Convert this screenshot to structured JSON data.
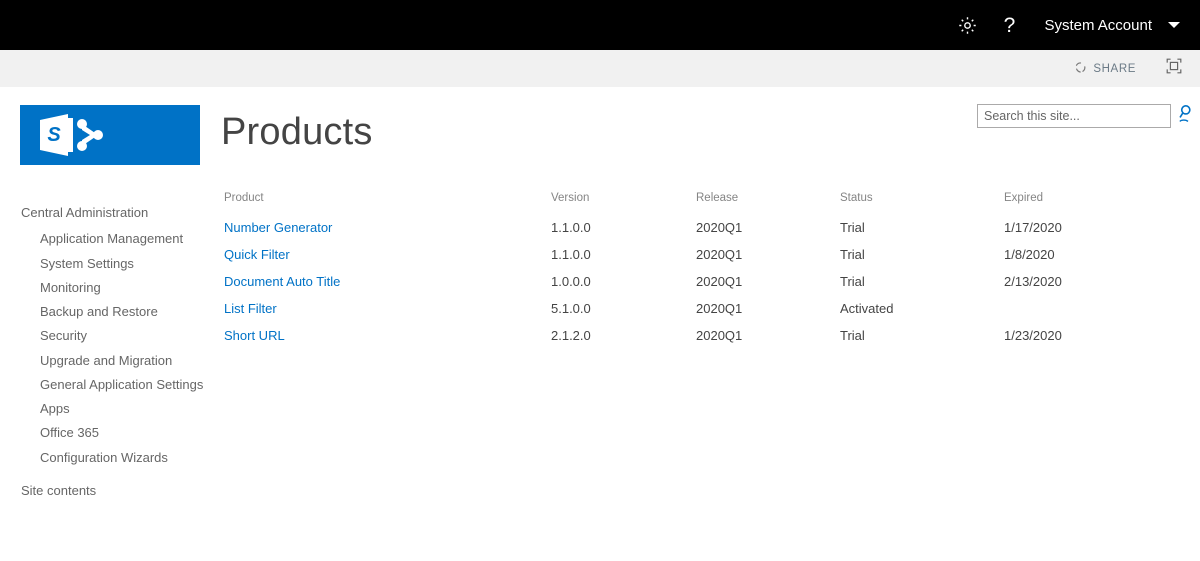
{
  "suitebar": {
    "settings_icon": "gear-icon",
    "help_icon": "question-mark-icon",
    "account_label": "System Account",
    "caret_icon": "chevron-down-icon"
  },
  "ribbon": {
    "share_icon": "share-icon",
    "share_label": "SHARE",
    "focus_icon": "focus-on-content-icon"
  },
  "branding": {
    "logo_icon": "sharepoint-logo-icon",
    "logo_color": "#0072c6",
    "logo_letter": "S"
  },
  "header": {
    "title": "Products"
  },
  "search": {
    "placeholder": "Search this site...",
    "value": "",
    "icon": "search-icon",
    "icon_color": "#0072c6"
  },
  "sidebar": {
    "items": [
      {
        "label": "Central Administration",
        "level": "top"
      },
      {
        "label": "Application Management",
        "level": "child"
      },
      {
        "label": "System Settings",
        "level": "child"
      },
      {
        "label": "Monitoring",
        "level": "child"
      },
      {
        "label": "Backup and Restore",
        "level": "child"
      },
      {
        "label": "Security",
        "level": "child"
      },
      {
        "label": "Upgrade and Migration",
        "level": "child"
      },
      {
        "label": "General Application Settings",
        "level": "child"
      },
      {
        "label": "Apps",
        "level": "child"
      },
      {
        "label": "Office 365",
        "level": "child"
      },
      {
        "label": "Configuration Wizards",
        "level": "child"
      },
      {
        "label": "Site contents",
        "level": "bottom"
      }
    ]
  },
  "main": {
    "table": {
      "columns": [
        "Product",
        "Version",
        "Release",
        "Status",
        "Expired"
      ],
      "rows": [
        {
          "product": "Number Generator",
          "version": "1.1.0.0",
          "release": "2020Q1",
          "status": "Trial",
          "expired": "1/17/2020"
        },
        {
          "product": "Quick Filter",
          "version": "1.1.0.0",
          "release": "2020Q1",
          "status": "Trial",
          "expired": "1/8/2020"
        },
        {
          "product": "Document Auto Title",
          "version": "1.0.0.0",
          "release": "2020Q1",
          "status": "Trial",
          "expired": "2/13/2020"
        },
        {
          "product": "List Filter",
          "version": "5.1.0.0",
          "release": "2020Q1",
          "status": "Activated",
          "expired": ""
        },
        {
          "product": "Short URL",
          "version": "2.1.2.0",
          "release": "2020Q1",
          "status": "Trial",
          "expired": "1/23/2020"
        }
      ]
    }
  },
  "colors": {
    "accent": "#0072c6",
    "suitebar_bg": "#000000",
    "ribbon_bg": "#f1f1f1",
    "text": "#444444",
    "muted": "#666666"
  }
}
